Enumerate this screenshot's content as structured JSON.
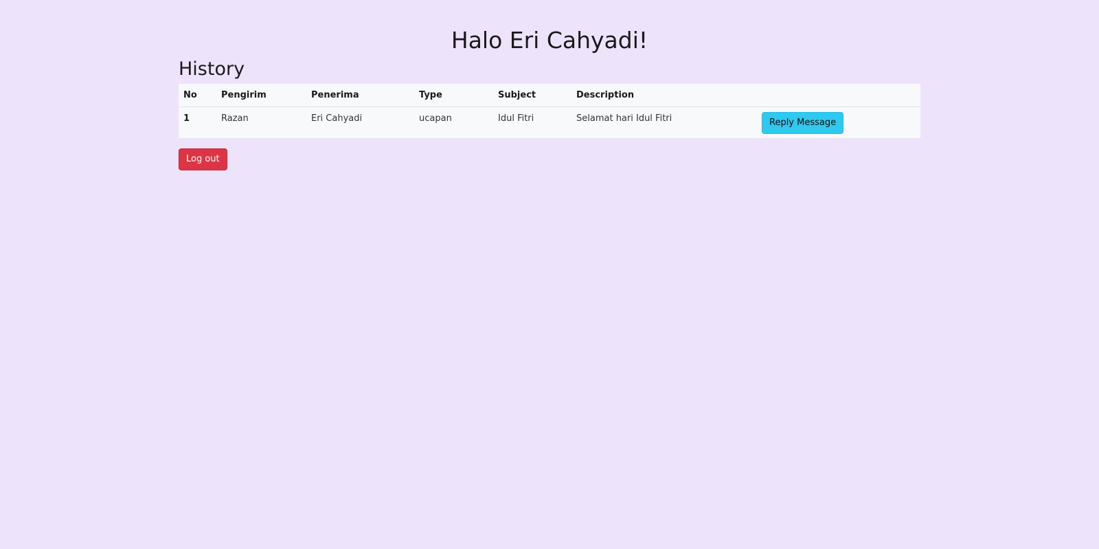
{
  "greeting": "Halo Eri Cahyadi!",
  "history": {
    "title": "History",
    "columns": [
      "No",
      "Pengirim",
      "Penerima",
      "Type",
      "Subject",
      "Description"
    ],
    "rows": [
      {
        "no": "1",
        "pengirim": "Razan",
        "penerima": "Eri Cahyadi",
        "type": "ucapan",
        "subject": "Idul Fitri",
        "description": "Selamat hari Idul Fitri",
        "action_label": "Reply Message"
      }
    ]
  },
  "logout_label": "Log out",
  "colors": {
    "background": "#ede3fb",
    "table_bg": "#f8f9fa",
    "reply_button": "#2fc8ef",
    "logout_button": "#dc3545"
  }
}
